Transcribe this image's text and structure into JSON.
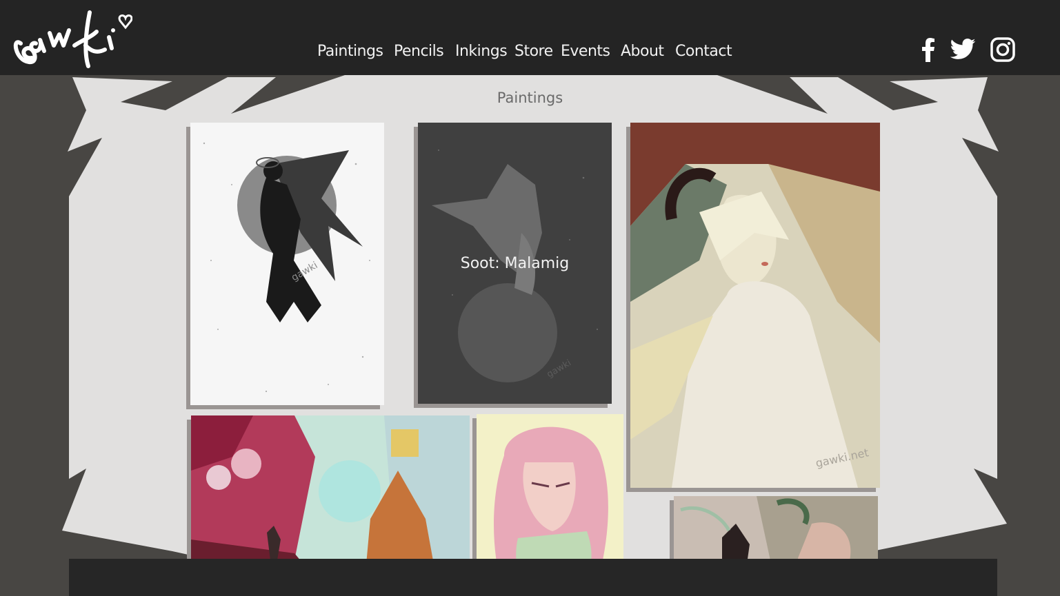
{
  "brand": {
    "logo_text": "gawki"
  },
  "nav": {
    "items": [
      {
        "label": "Paintings"
      },
      {
        "label": "Pencils"
      },
      {
        "label": "Inkings"
      },
      {
        "label": "Store"
      },
      {
        "label": "Events"
      },
      {
        "label": "About"
      },
      {
        "label": "Contact"
      }
    ]
  },
  "social": {
    "icons": [
      "facebook-icon",
      "twitter-icon",
      "instagram-icon"
    ]
  },
  "gallery": {
    "title": "Paintings",
    "hover_title": "Soot: Malamig",
    "artworks": [
      {
        "id": "angel-silhouette",
        "watermark": "gawki"
      },
      {
        "id": "soot-malamig",
        "watermark": "gawki"
      },
      {
        "id": "pale-angel",
        "watermark": "gawki.net"
      },
      {
        "id": "castle-landscape"
      },
      {
        "id": "pink-hair-portrait"
      },
      {
        "id": "horned-portrait"
      }
    ]
  },
  "colors": {
    "topbar": "#242424",
    "panel": "#e1e0df",
    "branches": "#484643",
    "nav_text": "#f1f1f1",
    "title_text": "#6a6a6a"
  }
}
